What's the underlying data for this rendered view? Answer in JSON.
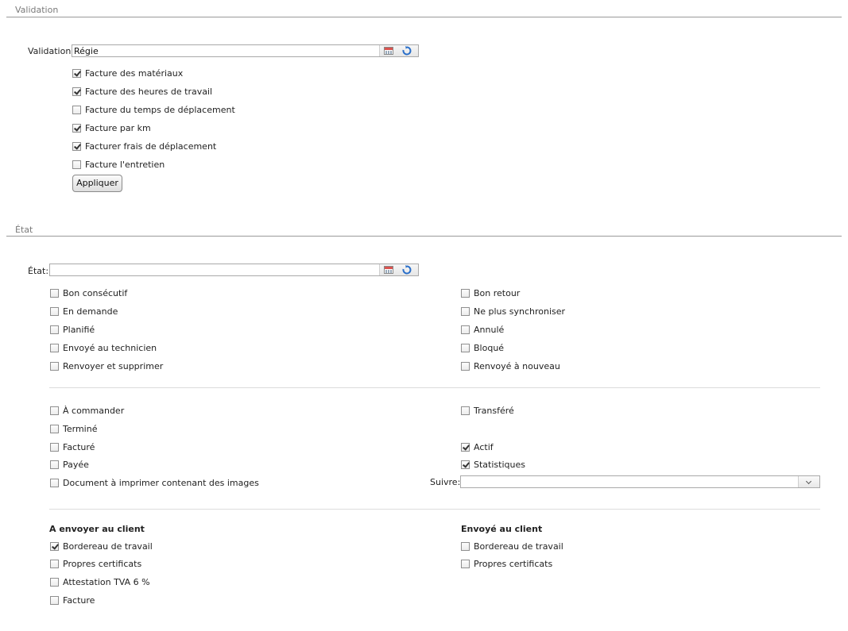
{
  "validation": {
    "section_title": "Validation",
    "field_label": "Validation:",
    "field_value": "Régie",
    "checkboxes": [
      {
        "label": "Facture des matériaux",
        "checked": true
      },
      {
        "label": "Facture des heures de travail",
        "checked": true
      },
      {
        "label": "Facture du temps de déplacement",
        "checked": false
      },
      {
        "label": "Facture par km",
        "checked": true
      },
      {
        "label": "Facturer frais de déplacement",
        "checked": true
      },
      {
        "label": "Facture l'entretien",
        "checked": false
      }
    ],
    "apply_label": "Appliquer"
  },
  "etat": {
    "section_title": "État",
    "field_label": "État:",
    "field_value": "",
    "group1_left": [
      {
        "label": "Bon consécutif",
        "checked": false
      },
      {
        "label": "En demande",
        "checked": false
      },
      {
        "label": "Planifié",
        "checked": false
      },
      {
        "label": "Envoyé au technicien",
        "checked": false
      },
      {
        "label": "Renvoyer et supprimer",
        "checked": false
      }
    ],
    "group1_right": [
      {
        "label": "Bon retour",
        "checked": false
      },
      {
        "label": "Ne plus synchroniser",
        "checked": false
      },
      {
        "label": "Annulé",
        "checked": false
      },
      {
        "label": "Bloqué",
        "checked": false
      },
      {
        "label": "Renvoyé à nouveau",
        "checked": false
      }
    ],
    "group2_left": [
      {
        "label": "À commander",
        "checked": false
      },
      {
        "label": "Terminé",
        "checked": false
      },
      {
        "label": "Facturé",
        "checked": false
      },
      {
        "label": "Payée",
        "checked": false
      },
      {
        "label": "Document à imprimer contenant des images",
        "checked": false
      }
    ],
    "group2_right": [
      {
        "label": "Transféré",
        "checked": false
      },
      {
        "label": "Actif",
        "checked": true
      },
      {
        "label": "Statistiques",
        "checked": true
      }
    ],
    "follow_label": "Suivre:",
    "follow_value": "",
    "send_left_title": "A envoyer au client",
    "send_left": [
      {
        "label": "Bordereau de travail",
        "checked": true
      },
      {
        "label": "Propres certificats",
        "checked": false
      },
      {
        "label": "Attestation TVA 6 %",
        "checked": false
      },
      {
        "label": "Facture",
        "checked": false
      }
    ],
    "send_right_title": "Envoyé au client",
    "send_right": [
      {
        "label": "Bordereau de travail",
        "checked": false
      },
      {
        "label": "Propres certificats",
        "checked": false
      }
    ]
  }
}
